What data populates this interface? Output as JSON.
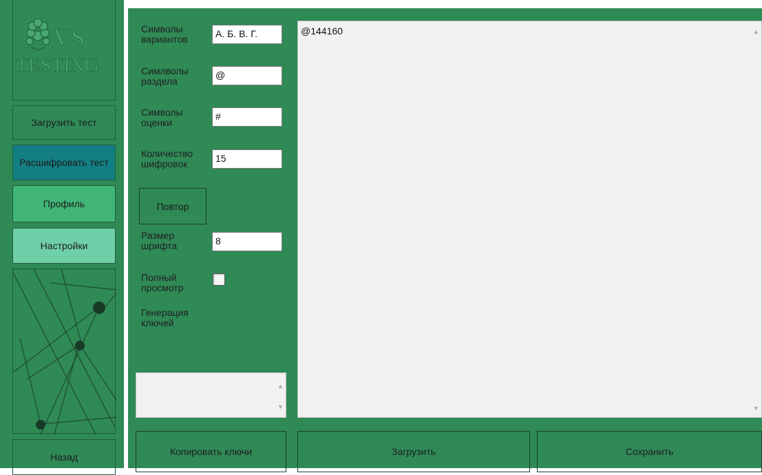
{
  "sidebar": {
    "logo": {
      "text_top": "VS",
      "text_bottom": "TESTING"
    },
    "load_test": "Загрузить тест",
    "decrypt_test": "Расшифровать тест",
    "profile": "Профиль",
    "settings": "Настройки",
    "back": "Назад"
  },
  "form": {
    "variant_symbols": {
      "label": "Символы вариантов",
      "value": "А. Б. В. Г."
    },
    "section_symbols": {
      "label": "Симлволы раздела",
      "value": "@"
    },
    "score_symbols": {
      "label": "Символы оценки",
      "value": "#"
    },
    "cipher_count": {
      "label": "Количество шифровок",
      "value": "15"
    },
    "repeat_button": "Повтор",
    "font_size": {
      "label": "Размер шрифта",
      "value": "8"
    },
    "full_view": {
      "label": "Полный просмотр",
      "checked": false
    },
    "key_generation_label": "Генерация ключей",
    "keys_output": ""
  },
  "editor": {
    "content": "@144160"
  },
  "buttons": {
    "copy_keys": "Копировать ключи",
    "load": "Загрузить",
    "save": "Сохранить"
  },
  "colors": {
    "background_green": "#2f8a56",
    "decrypt_active": "#137f84",
    "profile": "#40b576",
    "settings": "#6fcfa8"
  }
}
